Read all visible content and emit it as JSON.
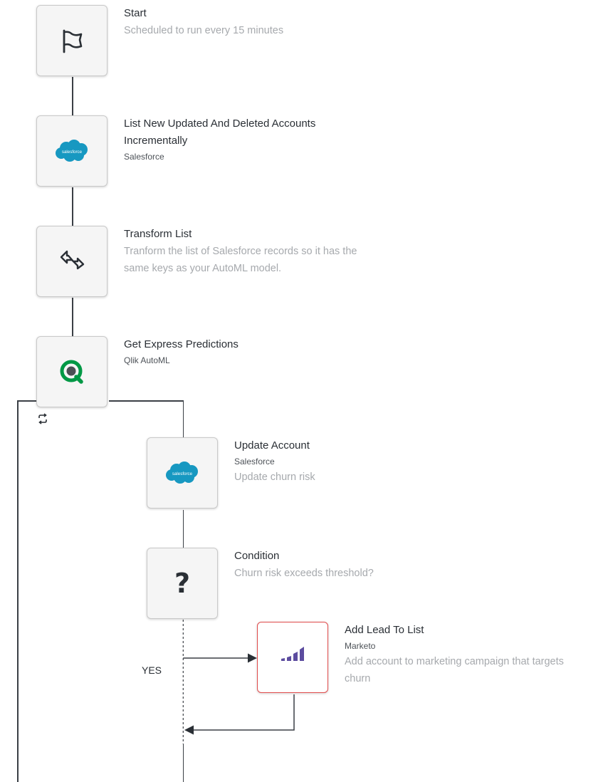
{
  "steps": {
    "start": {
      "title": "Start",
      "description": "Scheduled to run every 15 minutes",
      "icon": "flag-icon"
    },
    "list_accounts": {
      "title_line1": "List New Updated And Deleted Accounts",
      "title_line2": "Incrementally",
      "subtitle": "Salesforce",
      "icon": "salesforce-logo-icon",
      "logo_text": "salesforce"
    },
    "transform": {
      "title": "Transform List",
      "description_line1": "Tranform the list of Salesforce records so it has the",
      "description_line2": "same keys as your AutoML model.",
      "icon": "transform-arrow-icon"
    },
    "predictions": {
      "title": "Get Express Predictions",
      "subtitle": "Qlik AutoML",
      "icon": "qlik-logo-icon"
    },
    "update_account": {
      "title": "Update Account",
      "subtitle": "Salesforce",
      "description": "Update churn risk",
      "icon": "salesforce-logo-icon",
      "logo_text": "salesforce"
    },
    "condition": {
      "title": "Condition",
      "description": "Churn risk exceeds threshold?",
      "icon": "question-mark-icon",
      "symbol": "?"
    },
    "add_lead": {
      "title": "Add Lead To List",
      "subtitle": "Marketo",
      "description_line1": "Add account to marketing campaign that targets",
      "description_line2": "churn",
      "icon": "marketo-logo-icon",
      "state_color": "#e04b4b"
    }
  },
  "branch": {
    "yes_label": "YES"
  },
  "loop": {
    "icon": "loop-icon"
  },
  "colors": {
    "salesforce_blue": "#1798c1",
    "qlik_green": "#009845",
    "marketo_purple": "#5c4c9f",
    "connector": "#3a3f45",
    "error_border": "#e04b4b"
  }
}
